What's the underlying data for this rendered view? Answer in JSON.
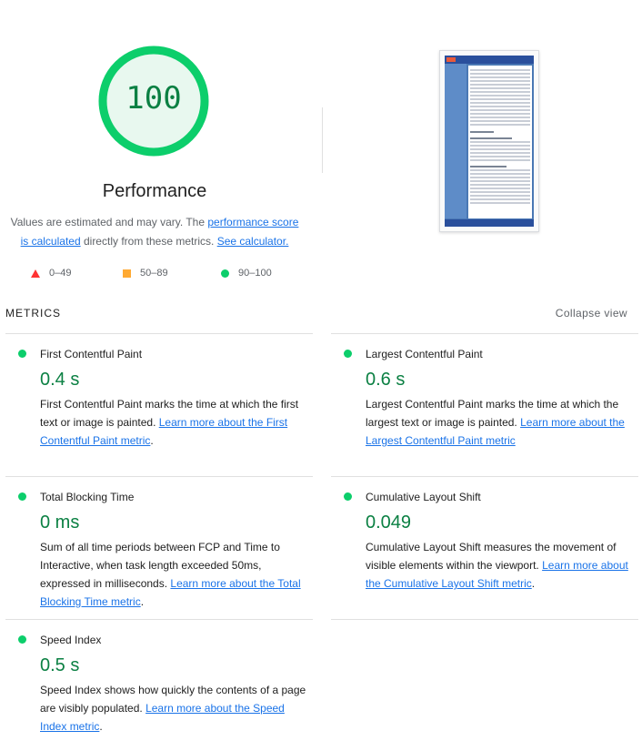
{
  "score": {
    "value": "100",
    "title": "Performance",
    "fraction": 1.0,
    "color": "#0cce6b"
  },
  "disclaimer": {
    "text_before": "Values are estimated and may vary. The ",
    "link1": "performance score is calculated",
    "text_middle": " directly from these metrics. ",
    "link2": "See calculator."
  },
  "legend": {
    "fail": "0–49",
    "average": "50–89",
    "pass": "90–100"
  },
  "metrics_section": {
    "header": "METRICS",
    "collapse": "Collapse view"
  },
  "metrics": {
    "fcp": {
      "title": "First Contentful Paint",
      "value": "0.4 s",
      "desc": "First Contentful Paint marks the time at which the first text or image is painted. ",
      "link": "Learn more about the First Contentful Paint metric",
      "tail": "."
    },
    "lcp": {
      "title": "Largest Contentful Paint",
      "value": "0.6 s",
      "desc": "Largest Contentful Paint marks the time at which the largest text or image is painted. ",
      "link": "Learn more about the Largest Contentful Paint metric",
      "tail": ""
    },
    "tbt": {
      "title": "Total Blocking Time",
      "value": "0 ms",
      "desc": "Sum of all time periods between FCP and Time to Interactive, when task length exceeded 50ms, expressed in milliseconds. ",
      "link": "Learn more about the Total Blocking Time metric",
      "tail": "."
    },
    "cls": {
      "title": "Cumulative Layout Shift",
      "value": "0.049",
      "desc": "Cumulative Layout Shift measures the movement of visible elements within the viewport. ",
      "link": "Learn more about the Cumulative Layout Shift metric",
      "tail": "."
    },
    "si": {
      "title": "Speed Index",
      "value": "0.5 s",
      "desc": "Speed Index shows how quickly the contents of a page are visibly populated. ",
      "link": "Learn more about the Speed Index metric",
      "tail": "."
    }
  }
}
